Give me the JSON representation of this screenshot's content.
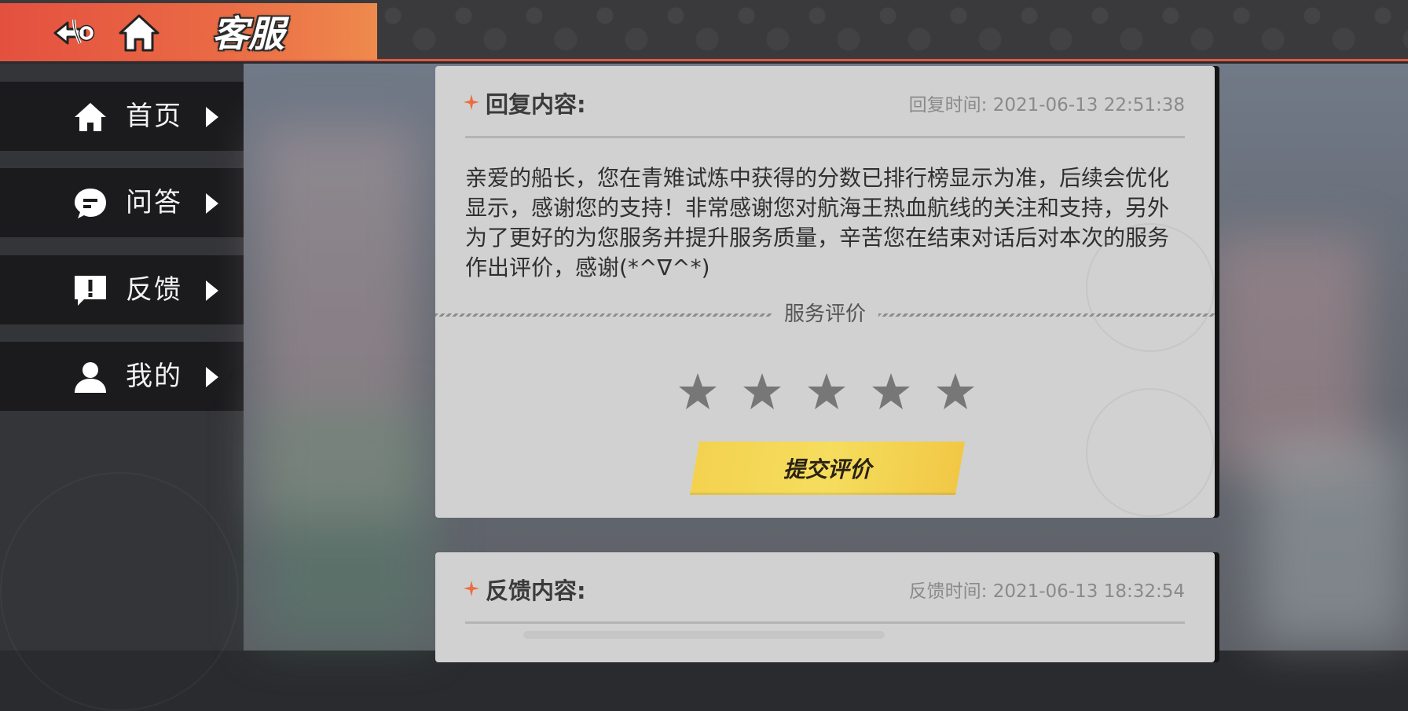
{
  "header": {
    "title": "客服",
    "back_icon": "anchor-back-icon",
    "home_icon": "home-icon",
    "accent_color": "#e4503f"
  },
  "sidebar": {
    "items": [
      {
        "label": "首页",
        "icon": "home-icon"
      },
      {
        "label": "问答",
        "icon": "chat-bubble-icon"
      },
      {
        "label": "反馈",
        "icon": "exclamation-bubble-icon"
      },
      {
        "label": "我的",
        "icon": "person-icon"
      }
    ]
  },
  "reply_card": {
    "heading": "回复内容:",
    "time_text": "回复时间: 2021-06-13 22:51:38",
    "body": "亲爱的船长，您在青雉试炼中获得的分数已排行榜显示为准，后续会优化显示，感谢您的支持！非常感谢您对航海王热血航线的关注和支持，另外为了更好的为您服务并提升服务质量，辛苦您在结束对话后对本次的服务作出评价，感谢(*^∇^*)",
    "rating_label": "服务评价",
    "rating": {
      "selected": 0,
      "max": 5
    },
    "submit_label": "提交评价"
  },
  "feedback_card": {
    "heading": "反馈内容:",
    "time_text": "反馈时间: 2021-06-13 18:32:54"
  }
}
